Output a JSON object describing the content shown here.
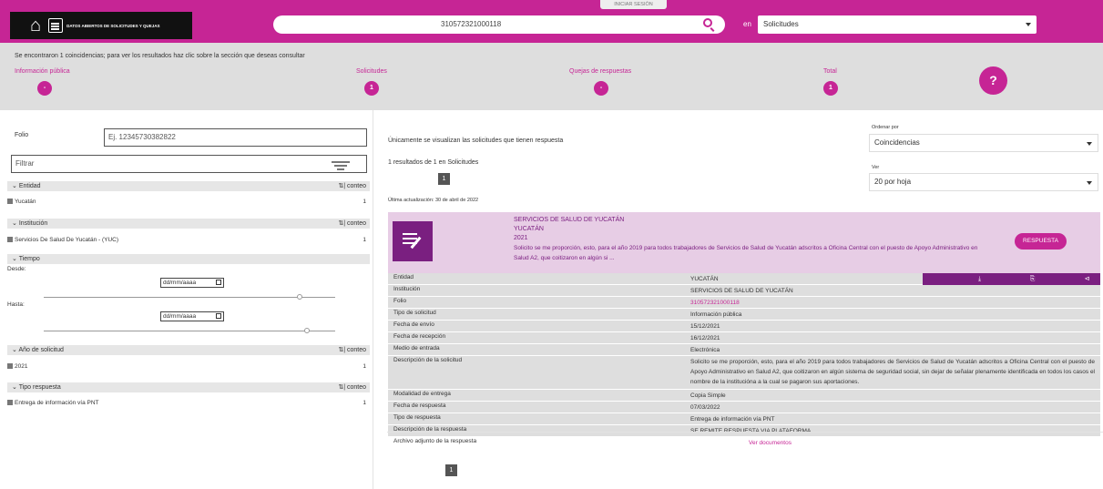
{
  "header": {
    "logo_text": "DATOS ABIERTOS DE SOLICITUDES Y QUEJAS",
    "login_tab": "INICIAR SESIÓN",
    "search_value": "310572321000118",
    "en_label": "en",
    "scope_selected": "Solicitudes",
    "brand_color": "#c62595"
  },
  "summary": {
    "message": "Se encontraron 1 coincidencias; para ver los resultados haz clic sobre la sección que deseas consultar",
    "items": [
      {
        "label": "Información pública",
        "badge": "-"
      },
      {
        "label": "Solicitudes",
        "badge": "1"
      },
      {
        "label": "Quejas de respuestas",
        "badge": "-"
      },
      {
        "label": "Total",
        "badge": "1"
      }
    ],
    "help": "?"
  },
  "filters": {
    "folio_label": "Folio",
    "folio_placeholder": "Ej. 12345730382822",
    "filter_placeholder": "Filtrar",
    "sort_label": "conteo",
    "sections": [
      {
        "title": "Entidad",
        "rows": [
          {
            "label": "Yucatán",
            "count": "1"
          }
        ]
      },
      {
        "title": "Institución",
        "rows": [
          {
            "label": "Servicios De Salud De Yucatán - (YUC)",
            "count": "1"
          }
        ]
      },
      {
        "title": "Tiempo"
      },
      {
        "title": "Año de solicitud",
        "rows": [
          {
            "label": "2021",
            "count": "1"
          }
        ]
      },
      {
        "title": "Tipo respuesta",
        "rows": [
          {
            "label": "Entrega de información vía PNT",
            "count": "1"
          }
        ]
      }
    ],
    "desde_label": "Desde:",
    "hasta_label": "Hasta:",
    "date_placeholder": "dd/mm/aaaa"
  },
  "results": {
    "info": "Únicamente se visualizan las solicitudes que tienen respuesta",
    "count_text": "1 resultados de 1 en Solicitudes",
    "page": "1",
    "order_label": "Ordenar por",
    "order_value": "Coincidencias",
    "ver_label": "Ver",
    "ver_value": "20 por hoja",
    "updated": "Última actualización: 30 de abril de 2022"
  },
  "card": {
    "institution": "SERVICIOS DE SALUD DE YUCATÁN",
    "state": "YUCATÁN",
    "year": "2021",
    "desc": "Solicito se me proporción, esto, para el año 2019 para todos trabajadores de Servicios de Salud de Yucatán adscritos a Oficina Central con el puesto de Apoyo Administrativo en Salud A2, que coitizaron en algún si ...",
    "button": "RESPUESTA"
  },
  "details": [
    {
      "key": "Entidad",
      "value": "YUCATÁN"
    },
    {
      "key": "Institución",
      "value": "SERVICIOS DE SALUD DE YUCATÁN"
    },
    {
      "key": "Folio",
      "value": "310572321000118"
    },
    {
      "key": "Tipo de solicitud",
      "value": "Información pública"
    },
    {
      "key": "Fecha de envío",
      "value": "15/12/2021"
    },
    {
      "key": "Fecha de recepción",
      "value": "16/12/2021"
    },
    {
      "key": "Medio de entrada",
      "value": "Electrónica"
    },
    {
      "key": "Descripción de la solicitud",
      "value": "Solicito se me proporción, esto, para el año 2019 para todos trabajadores de Servicios de Salud de Yucatán adscritos a Oficina Central con el puesto de Apoyo Administrativo en Salud A2, que coitizaron en algún sistema de seguridad social, sin dejar de señalar plenamente identificada en todos los casos el nombre de la institucióna a la cual se pagaron sus aportaciones."
    },
    {
      "key": "Modalidad de entrega",
      "value": "Copia Simple"
    },
    {
      "key": "Fecha de respuesta",
      "value": "07/03/2022"
    },
    {
      "key": "Tipo de respuesta",
      "value": "Entrega de información vía PNT"
    },
    {
      "key": "Descripción de la respuesta",
      "value": "SE REMITE RESPUESTA VIA PLATAFORMA"
    },
    {
      "key": "Archivo adjunto de la respuesta",
      "value": "Ver documentos"
    }
  ]
}
